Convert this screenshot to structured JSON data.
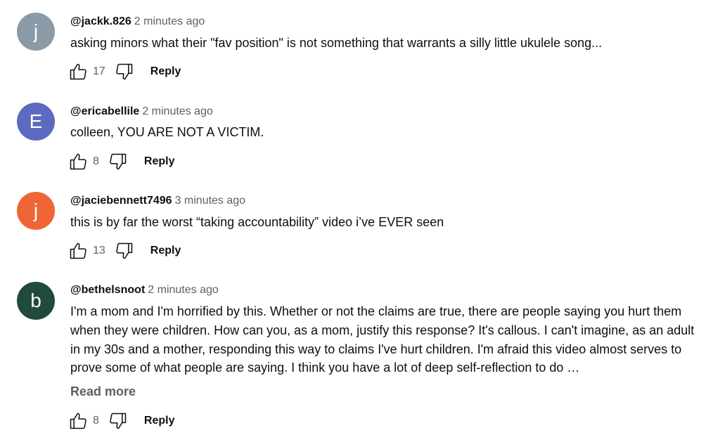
{
  "comments": [
    {
      "avatar_letter": "j",
      "avatar_color": "#8a9aa6",
      "author": "@jackk.826",
      "time": "2 minutes ago",
      "text": "asking minors what their \"fav position\" is not something that warrants a silly little ukulele song...",
      "likes": "17",
      "reply_label": "Reply"
    },
    {
      "avatar_letter": "E",
      "avatar_color": "#5c6bc0",
      "author": "@ericabellile",
      "time": "2 minutes ago",
      "text": "colleen, YOU ARE NOT A VICTIM.",
      "likes": "8",
      "reply_label": "Reply"
    },
    {
      "avatar_letter": "j",
      "avatar_color": "#ef6536",
      "author": "@jaciebennett7496",
      "time": "3 minutes ago",
      "text": "this is by far the worst “taking accountability” video i’ve EVER seen",
      "likes": "13",
      "reply_label": "Reply"
    },
    {
      "avatar_letter": "b",
      "avatar_color": "#1f4a3c",
      "author": "@bethelsnoot",
      "time": "2 minutes ago",
      "text": "I'm a mom and I'm horrified by this. Whether or not the claims are true, there are people saying you hurt them when they were children. How can you, as a mom, justify this response? It's callous. I can't imagine, as an adult in my 30s and a mother, responding this way to claims I've hurt children. I'm afraid this video almost serves to prove some of what people are saying. I think you have a lot of deep self-reflection to do …",
      "read_more": "Read more",
      "likes": "8",
      "reply_label": "Reply"
    }
  ],
  "colors": {
    "text": "#0f0f0f",
    "secondary": "#606060"
  },
  "icons": {
    "like": "thumbs-up-icon",
    "dislike": "thumbs-down-icon"
  }
}
